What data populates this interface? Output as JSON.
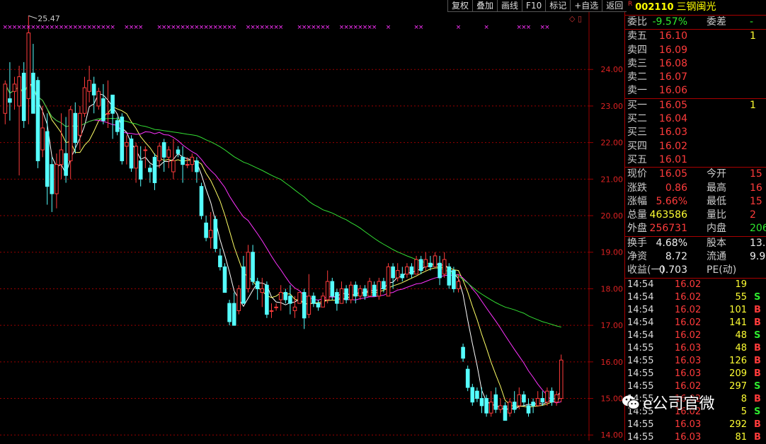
{
  "toolbar": {
    "buttons": [
      "复权",
      "叠加",
      "画线",
      "F10",
      "标记",
      "+自选",
      "返回"
    ]
  },
  "side_icons": "◇ ▯",
  "header": {
    "badge": "R",
    "code": "002110",
    "name": "三钢闽光"
  },
  "quote": {
    "weibi": {
      "label": "委比",
      "value": "-9.57%",
      "label2": "委差",
      "value2": "-"
    },
    "sell": [
      {
        "label": "卖五",
        "price": "16.10",
        "vol": "1"
      },
      {
        "label": "卖四",
        "price": "16.09",
        "vol": ""
      },
      {
        "label": "卖三",
        "price": "16.08",
        "vol": ""
      },
      {
        "label": "卖二",
        "price": "16.07",
        "vol": ""
      },
      {
        "label": "卖一",
        "price": "16.06",
        "vol": ""
      }
    ],
    "buy": [
      {
        "label": "买一",
        "price": "16.05",
        "vol": "1"
      },
      {
        "label": "买二",
        "price": "16.04",
        "vol": ""
      },
      {
        "label": "买三",
        "price": "16.03",
        "vol": ""
      },
      {
        "label": "买四",
        "price": "16.02",
        "vol": ""
      },
      {
        "label": "买五",
        "price": "16.01",
        "vol": ""
      }
    ],
    "stats1": [
      {
        "l1": "现价",
        "v1": "16.05",
        "c1": "red",
        "l2": "今开",
        "v2": "15",
        "c2": "red"
      },
      {
        "l1": "涨跌",
        "v1": "0.86",
        "c1": "red",
        "l2": "最高",
        "v2": "16",
        "c2": "red"
      },
      {
        "l1": "涨幅",
        "v1": "5.66%",
        "c1": "red",
        "l2": "最低",
        "v2": "15",
        "c2": "red"
      },
      {
        "l1": "总量",
        "v1": "463586",
        "c1": "yellow",
        "l2": "量比",
        "v2": "2",
        "c2": "red"
      },
      {
        "l1": "外盘",
        "v1": "256731",
        "c1": "red",
        "l2": "内盘",
        "v2": "206",
        "c2": "green"
      }
    ],
    "stats2": [
      {
        "l1": "换手",
        "v1": "4.68%",
        "c1": "white",
        "l2": "股本",
        "v2": "13.",
        "c2": "white"
      },
      {
        "l1": "净资",
        "v1": "8.72",
        "c1": "white",
        "l2": "流通",
        "v2": "9.9",
        "c2": "white"
      },
      {
        "l1": "收益(一)",
        "v1": "0.703",
        "c1": "white",
        "l2": "PE(动)",
        "v2": "",
        "c2": "white"
      }
    ]
  },
  "ticks": [
    {
      "time": "14:54",
      "price": "16.02",
      "vol": "19",
      "dir": ""
    },
    {
      "time": "14:54",
      "price": "16.02",
      "vol": "55",
      "dir": "S"
    },
    {
      "time": "14:54",
      "price": "16.02",
      "vol": "101",
      "dir": "B"
    },
    {
      "time": "14:54",
      "price": "16.02",
      "vol": "141",
      "dir": "B"
    },
    {
      "time": "14:54",
      "price": "16.02",
      "vol": "48",
      "dir": "S"
    },
    {
      "time": "14:55",
      "price": "16.03",
      "vol": "48",
      "dir": "B"
    },
    {
      "time": "14:55",
      "price": "16.03",
      "vol": "126",
      "dir": "B"
    },
    {
      "time": "14:55",
      "price": "16.03",
      "vol": "209",
      "dir": "B"
    },
    {
      "time": "14:55",
      "price": "16.02",
      "vol": "297",
      "dir": "S"
    },
    {
      "time": "14:55",
      "price": "16.02",
      "vol": "8",
      "dir": "B"
    },
    {
      "time": "14:55",
      "price": "16.02",
      "vol": "5",
      "dir": "S"
    },
    {
      "time": "14:55",
      "price": "16.03",
      "vol": "292",
      "dir": "B"
    },
    {
      "time": "14:55",
      "price": "16.03",
      "vol": "81",
      "dir": "B"
    }
  ],
  "colors": {
    "up": "#ff3b3b",
    "down": "#55ffff",
    "ma5": "#ffffff",
    "ma10": "#ffff66",
    "ma20": "#ff33ff",
    "ma60": "#33dd33",
    "grid": "#990000",
    "sell_label_bg": "#000000"
  },
  "watermark": {
    "text": "e公司官微",
    "icon": "wechat-icon"
  },
  "chart_data": {
    "type": "candlestick",
    "title": "",
    "xlabel": "",
    "ylabel": "",
    "ylim": [
      13.85,
      25.9
    ],
    "yticks": [
      "24.00",
      "23.00",
      "22.00",
      "21.00",
      "20.00",
      "19.00",
      "18.00",
      "17.00",
      "16.00",
      "15.00",
      "14.00"
    ],
    "annotation": {
      "label": "25.47",
      "value": 25.47,
      "index": 5
    },
    "marker_row": "× markers",
    "candles": [
      [
        22.8,
        23.6,
        22.5,
        23.7
      ],
      [
        23.2,
        23.1,
        22.6,
        24.2
      ],
      [
        23.4,
        23.6,
        22.9,
        23.8
      ],
      [
        23.0,
        23.8,
        21.1,
        24.1
      ],
      [
        23.9,
        22.6,
        22.4,
        24.2
      ],
      [
        23.2,
        25.0,
        22.5,
        25.47
      ],
      [
        23.9,
        22.8,
        22.8,
        24.7
      ],
      [
        23.7,
        21.5,
        21.3,
        23.8
      ],
      [
        21.8,
        22.4,
        21.6,
        23.0
      ],
      [
        22.3,
        20.8,
        20.3,
        22.8
      ],
      [
        21.4,
        20.6,
        20.1,
        21.6
      ],
      [
        20.6,
        21.4,
        20.2,
        21.7
      ],
      [
        21.4,
        21.8,
        21.0,
        22.8
      ],
      [
        21.7,
        21.1,
        20.9,
        22.7
      ],
      [
        21.5,
        22.9,
        21.0,
        23.0
      ],
      [
        22.8,
        22.0,
        21.7,
        23.1
      ],
      [
        22.2,
        22.8,
        21.8,
        23.0
      ],
      [
        22.8,
        23.5,
        22.7,
        23.8
      ],
      [
        23.4,
        23.7,
        23.1,
        24.1
      ],
      [
        23.6,
        23.3,
        22.8,
        23.8
      ],
      [
        23.0,
        23.4,
        22.9,
        23.5
      ],
      [
        23.2,
        22.6,
        22.5,
        23.6
      ],
      [
        22.8,
        22.8,
        22.4,
        23.7
      ],
      [
        23.3,
        22.8,
        22.1,
        23.3
      ],
      [
        22.6,
        22.3,
        22.2,
        22.7
      ],
      [
        22.7,
        21.5,
        21.4,
        22.8
      ],
      [
        21.9,
        22.0,
        21.4,
        22.2
      ],
      [
        22.1,
        21.3,
        21.2,
        22.2
      ],
      [
        21.3,
        21.9,
        20.9,
        22.0
      ],
      [
        21.5,
        21.0,
        20.8,
        21.9
      ],
      [
        21.8,
        21.8,
        21.3,
        21.9
      ],
      [
        21.3,
        21.2,
        20.9,
        21.4
      ],
      [
        21.6,
        20.9,
        20.7,
        21.7
      ],
      [
        21.5,
        21.9,
        21.3,
        22.0
      ],
      [
        22.0,
        21.6,
        21.2,
        22.1
      ],
      [
        21.6,
        21.8,
        21.3,
        21.9
      ],
      [
        21.2,
        21.5,
        21.0,
        22.1
      ],
      [
        21.8,
        21.7,
        21.6,
        21.9
      ],
      [
        21.6,
        21.4,
        20.9,
        21.9
      ],
      [
        21.4,
        21.4,
        21.3,
        21.6
      ],
      [
        21.4,
        21.6,
        21.2,
        21.7
      ],
      [
        21.5,
        21.2,
        20.9,
        21.6
      ],
      [
        20.8,
        20.0,
        19.9,
        20.9
      ],
      [
        19.8,
        19.4,
        19.3,
        20.0
      ],
      [
        19.4,
        19.6,
        19.1,
        20.1
      ],
      [
        19.9,
        19.1,
        19.0,
        20.0
      ],
      [
        18.9,
        18.6,
        18.5,
        19.1
      ],
      [
        18.6,
        17.9,
        17.9,
        18.7
      ],
      [
        17.6,
        17.1,
        17.0,
        17.7
      ],
      [
        17.6,
        17.0,
        17.0,
        17.9
      ],
      [
        17.4,
        18.0,
        17.3,
        18.1
      ],
      [
        18.6,
        17.6,
        17.6,
        18.9
      ],
      [
        18.0,
        19.0,
        17.9,
        19.2
      ],
      [
        19.0,
        18.2,
        18.1,
        19.2
      ],
      [
        18.2,
        18.0,
        17.7,
        18.3
      ],
      [
        17.9,
        18.0,
        17.5,
        18.3
      ],
      [
        18.1,
        17.3,
        17.2,
        18.2
      ],
      [
        17.4,
        17.4,
        17.2,
        17.6
      ],
      [
        17.5,
        17.5,
        17.4,
        17.6
      ],
      [
        17.7,
        17.9,
        17.4,
        18.1
      ],
      [
        17.9,
        17.7,
        17.6,
        18.0
      ],
      [
        17.8,
        17.6,
        17.3,
        18.1
      ],
      [
        17.4,
        17.5,
        17.2,
        17.8
      ],
      [
        17.6,
        17.9,
        17.6,
        17.9
      ],
      [
        17.9,
        17.2,
        16.9,
        18.0
      ],
      [
        17.3,
        17.8,
        17.2,
        18.4
      ],
      [
        17.8,
        17.6,
        17.5,
        17.9
      ],
      [
        17.6,
        17.5,
        17.4,
        17.7
      ],
      [
        17.5,
        17.8,
        17.5,
        17.9
      ],
      [
        17.7,
        18.2,
        17.6,
        18.5
      ],
      [
        18.2,
        17.8,
        17.7,
        18.3
      ],
      [
        17.9,
        17.6,
        17.4,
        18.0
      ],
      [
        17.6,
        18.0,
        17.6,
        18.2
      ],
      [
        18.0,
        17.7,
        17.6,
        18.1
      ],
      [
        17.7,
        18.1,
        17.6,
        18.2
      ],
      [
        18.1,
        17.8,
        17.6,
        18.2
      ],
      [
        17.8,
        18.0,
        17.7,
        18.1
      ],
      [
        18.0,
        17.8,
        17.7,
        18.1
      ],
      [
        17.8,
        18.2,
        17.8,
        18.3
      ],
      [
        18.1,
        17.8,
        17.8,
        18.2
      ],
      [
        17.8,
        18.2,
        17.7,
        18.3
      ],
      [
        18.2,
        18.0,
        17.9,
        18.3
      ],
      [
        17.8,
        18.6,
        17.8,
        18.7
      ],
      [
        18.6,
        18.3,
        18.0,
        18.7
      ],
      [
        18.3,
        18.5,
        18.2,
        18.7
      ],
      [
        18.4,
        18.3,
        18.2,
        18.6
      ],
      [
        18.4,
        18.6,
        18.3,
        18.7
      ],
      [
        18.6,
        18.4,
        18.3,
        18.7
      ],
      [
        18.4,
        18.8,
        18.4,
        18.9
      ],
      [
        18.8,
        18.5,
        18.4,
        18.9
      ],
      [
        18.6,
        18.8,
        18.5,
        19.0
      ],
      [
        18.7,
        18.6,
        18.5,
        18.9
      ],
      [
        18.6,
        18.9,
        18.6,
        19.0
      ],
      [
        18.7,
        18.3,
        18.1,
        18.9
      ],
      [
        18.4,
        18.8,
        18.3,
        19.0
      ],
      [
        18.6,
        18.1,
        18.0,
        18.7
      ],
      [
        18.5,
        18.0,
        17.9,
        18.6
      ],
      [
        18.0,
        18.2,
        17.9,
        18.4
      ],
      [
        16.4,
        16.1,
        16.0,
        16.5
      ],
      [
        15.8,
        15.3,
        15.2,
        15.9
      ],
      [
        15.3,
        14.9,
        14.8,
        15.4
      ],
      [
        15.2,
        15.0,
        14.9,
        15.3
      ],
      [
        15.0,
        14.8,
        14.6,
        15.3
      ],
      [
        15.0,
        14.6,
        14.5,
        15.1
      ],
      [
        14.6,
        14.9,
        14.5,
        15.2
      ],
      [
        15.1,
        14.7,
        14.6,
        15.3
      ],
      [
        14.7,
        14.8,
        14.6,
        15.0
      ],
      [
        14.8,
        14.4,
        14.4,
        14.9
      ],
      [
        14.6,
        14.9,
        14.5,
        15.0
      ],
      [
        14.9,
        14.7,
        14.6,
        15.2
      ],
      [
        14.8,
        15.1,
        14.7,
        15.3
      ],
      [
        15.1,
        14.9,
        14.8,
        15.2
      ],
      [
        14.8,
        14.6,
        14.5,
        15.0
      ],
      [
        14.9,
        14.8,
        14.6,
        15.0
      ],
      [
        14.8,
        15.0,
        14.8,
        15.2
      ],
      [
        15.0,
        14.9,
        14.8,
        15.2
      ],
      [
        14.9,
        15.2,
        14.8,
        15.3
      ],
      [
        15.2,
        14.9,
        14.8,
        15.3
      ],
      [
        14.9,
        15.1,
        14.8,
        15.2
      ],
      [
        15.0,
        16.05,
        14.9,
        16.2
      ]
    ]
  }
}
